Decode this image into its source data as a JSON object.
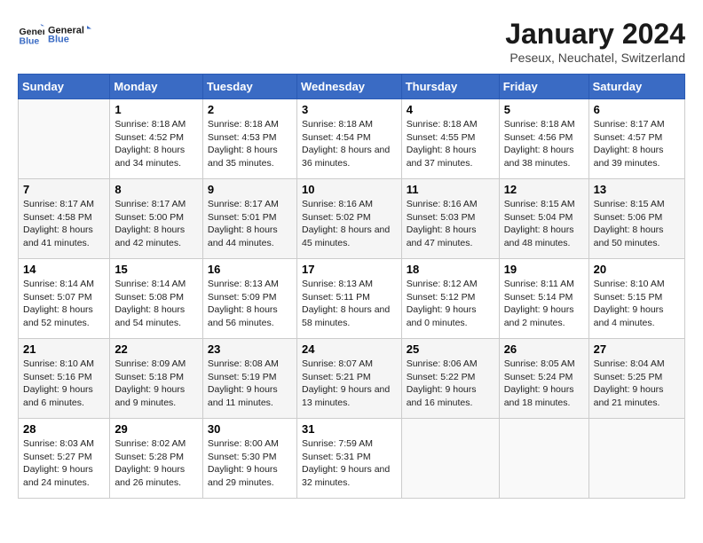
{
  "logo": {
    "line1": "General",
    "line2": "Blue"
  },
  "title": "January 2024",
  "subtitle": "Peseux, Neuchatel, Switzerland",
  "header_color": "#3a6bc4",
  "days_of_week": [
    "Sunday",
    "Monday",
    "Tuesday",
    "Wednesday",
    "Thursday",
    "Friday",
    "Saturday"
  ],
  "weeks": [
    [
      {
        "day": "",
        "sunrise": "",
        "sunset": "",
        "daylight": ""
      },
      {
        "day": "1",
        "sunrise": "8:18 AM",
        "sunset": "4:52 PM",
        "daylight": "8 hours and 34 minutes."
      },
      {
        "day": "2",
        "sunrise": "8:18 AM",
        "sunset": "4:53 PM",
        "daylight": "8 hours and 35 minutes."
      },
      {
        "day": "3",
        "sunrise": "8:18 AM",
        "sunset": "4:54 PM",
        "daylight": "8 hours and 36 minutes."
      },
      {
        "day": "4",
        "sunrise": "8:18 AM",
        "sunset": "4:55 PM",
        "daylight": "8 hours and 37 minutes."
      },
      {
        "day": "5",
        "sunrise": "8:18 AM",
        "sunset": "4:56 PM",
        "daylight": "8 hours and 38 minutes."
      },
      {
        "day": "6",
        "sunrise": "8:17 AM",
        "sunset": "4:57 PM",
        "daylight": "8 hours and 39 minutes."
      }
    ],
    [
      {
        "day": "7",
        "sunrise": "8:17 AM",
        "sunset": "4:58 PM",
        "daylight": "8 hours and 41 minutes."
      },
      {
        "day": "8",
        "sunrise": "8:17 AM",
        "sunset": "5:00 PM",
        "daylight": "8 hours and 42 minutes."
      },
      {
        "day": "9",
        "sunrise": "8:17 AM",
        "sunset": "5:01 PM",
        "daylight": "8 hours and 44 minutes."
      },
      {
        "day": "10",
        "sunrise": "8:16 AM",
        "sunset": "5:02 PM",
        "daylight": "8 hours and 45 minutes."
      },
      {
        "day": "11",
        "sunrise": "8:16 AM",
        "sunset": "5:03 PM",
        "daylight": "8 hours and 47 minutes."
      },
      {
        "day": "12",
        "sunrise": "8:15 AM",
        "sunset": "5:04 PM",
        "daylight": "8 hours and 48 minutes."
      },
      {
        "day": "13",
        "sunrise": "8:15 AM",
        "sunset": "5:06 PM",
        "daylight": "8 hours and 50 minutes."
      }
    ],
    [
      {
        "day": "14",
        "sunrise": "8:14 AM",
        "sunset": "5:07 PM",
        "daylight": "8 hours and 52 minutes."
      },
      {
        "day": "15",
        "sunrise": "8:14 AM",
        "sunset": "5:08 PM",
        "daylight": "8 hours and 54 minutes."
      },
      {
        "day": "16",
        "sunrise": "8:13 AM",
        "sunset": "5:09 PM",
        "daylight": "8 hours and 56 minutes."
      },
      {
        "day": "17",
        "sunrise": "8:13 AM",
        "sunset": "5:11 PM",
        "daylight": "8 hours and 58 minutes."
      },
      {
        "day": "18",
        "sunrise": "8:12 AM",
        "sunset": "5:12 PM",
        "daylight": "9 hours and 0 minutes."
      },
      {
        "day": "19",
        "sunrise": "8:11 AM",
        "sunset": "5:14 PM",
        "daylight": "9 hours and 2 minutes."
      },
      {
        "day": "20",
        "sunrise": "8:10 AM",
        "sunset": "5:15 PM",
        "daylight": "9 hours and 4 minutes."
      }
    ],
    [
      {
        "day": "21",
        "sunrise": "8:10 AM",
        "sunset": "5:16 PM",
        "daylight": "9 hours and 6 minutes."
      },
      {
        "day": "22",
        "sunrise": "8:09 AM",
        "sunset": "5:18 PM",
        "daylight": "9 hours and 9 minutes."
      },
      {
        "day": "23",
        "sunrise": "8:08 AM",
        "sunset": "5:19 PM",
        "daylight": "9 hours and 11 minutes."
      },
      {
        "day": "24",
        "sunrise": "8:07 AM",
        "sunset": "5:21 PM",
        "daylight": "9 hours and 13 minutes."
      },
      {
        "day": "25",
        "sunrise": "8:06 AM",
        "sunset": "5:22 PM",
        "daylight": "9 hours and 16 minutes."
      },
      {
        "day": "26",
        "sunrise": "8:05 AM",
        "sunset": "5:24 PM",
        "daylight": "9 hours and 18 minutes."
      },
      {
        "day": "27",
        "sunrise": "8:04 AM",
        "sunset": "5:25 PM",
        "daylight": "9 hours and 21 minutes."
      }
    ],
    [
      {
        "day": "28",
        "sunrise": "8:03 AM",
        "sunset": "5:27 PM",
        "daylight": "9 hours and 24 minutes."
      },
      {
        "day": "29",
        "sunrise": "8:02 AM",
        "sunset": "5:28 PM",
        "daylight": "9 hours and 26 minutes."
      },
      {
        "day": "30",
        "sunrise": "8:00 AM",
        "sunset": "5:30 PM",
        "daylight": "9 hours and 29 minutes."
      },
      {
        "day": "31",
        "sunrise": "7:59 AM",
        "sunset": "5:31 PM",
        "daylight": "9 hours and 32 minutes."
      },
      {
        "day": "",
        "sunrise": "",
        "sunset": "",
        "daylight": ""
      },
      {
        "day": "",
        "sunrise": "",
        "sunset": "",
        "daylight": ""
      },
      {
        "day": "",
        "sunrise": "",
        "sunset": "",
        "daylight": ""
      }
    ]
  ]
}
